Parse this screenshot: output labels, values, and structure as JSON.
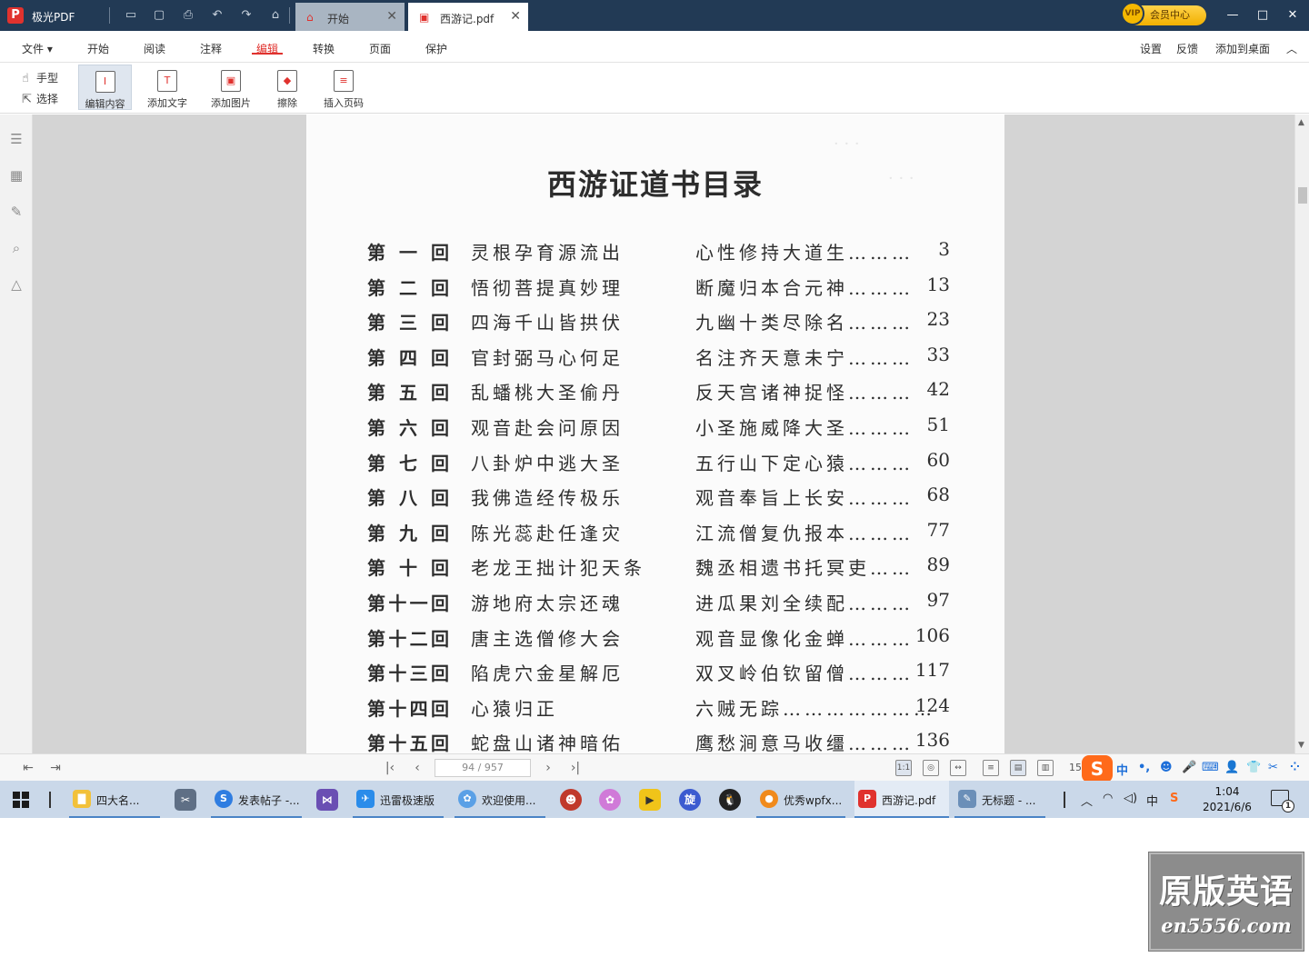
{
  "titlebar": {
    "app_name": "极光PDF",
    "tabs": [
      {
        "label": "开始",
        "active": false
      },
      {
        "label": "西游记.pdf",
        "active": true
      }
    ],
    "vip_label": "会员中心",
    "vip_badge": "VIP",
    "window_buttons": {
      "minimize": "—",
      "maximize": "□",
      "close": "✕"
    }
  },
  "menu": {
    "file": "文件 ▾",
    "items": [
      "开始",
      "阅读",
      "注释",
      "编辑",
      "转换",
      "页面",
      "保护"
    ],
    "active": "编辑",
    "right": [
      "设置",
      "反馈",
      "添加到桌面"
    ],
    "collapse": "︿"
  },
  "toolbar": {
    "hand": "手型",
    "select": "选择",
    "buttons": [
      {
        "label": "编辑内容",
        "glyph": "I",
        "selected": true
      },
      {
        "label": "添加文字",
        "glyph": "T",
        "selected": false
      },
      {
        "label": "添加图片",
        "glyph": "▣",
        "selected": false
      },
      {
        "label": "擦除",
        "glyph": "◆",
        "selected": false
      },
      {
        "label": "插入页码",
        "glyph": "≡",
        "selected": false
      }
    ]
  },
  "left_panel_icons": [
    "outline-icon",
    "thumbnails-icon",
    "annotations-icon",
    "search-icon",
    "signature-icon"
  ],
  "document": {
    "title": "西游证道书目录",
    "rows": [
      {
        "chapter": "第一回",
        "part1": "灵根孕育源流出",
        "part2": "心性修持大道生………",
        "page": "3"
      },
      {
        "chapter": "第二回",
        "part1": "悟彻菩提真妙理",
        "part2": "断魔归本合元神………",
        "page": "13"
      },
      {
        "chapter": "第三回",
        "part1": "四海千山皆拱伏",
        "part2": "九幽十类尽除名………",
        "page": "23"
      },
      {
        "chapter": "第四回",
        "part1": "官封弼马心何足",
        "part2": "名注齐天意未宁………",
        "page": "33"
      },
      {
        "chapter": "第五回",
        "part1": "乱蟠桃大圣偷丹",
        "part2": "反天宫诸神捉怪………",
        "page": "42"
      },
      {
        "chapter": "第六回",
        "part1": "观音赴会问原因",
        "part2": "小圣施威降大圣………",
        "page": "51"
      },
      {
        "chapter": "第七回",
        "part1": "八卦炉中逃大圣",
        "part2": "五行山下定心猿………",
        "page": "60"
      },
      {
        "chapter": "第八回",
        "part1": "我佛造经传极乐",
        "part2": "观音奉旨上长安………",
        "page": "68"
      },
      {
        "chapter": "第九回",
        "part1": "陈光蕊赴任逢灾",
        "part2": "江流僧复仇报本………",
        "page": "77"
      },
      {
        "chapter": "第十回",
        "part1": "老龙王拙计犯天条",
        "part2": "魏丞相遗书托冥吏……",
        "page": "89"
      },
      {
        "chapter": "第十一回",
        "part1": "游地府太宗还魂",
        "part2": "进瓜果刘全续配………",
        "page": "97"
      },
      {
        "chapter": "第十二回",
        "part1": "唐主选僧修大会",
        "part2": "观音显像化金蝉………",
        "page": "106"
      },
      {
        "chapter": "第十三回",
        "part1": "陷虎穴金星解厄",
        "part2": "双叉岭伯钦留僧………",
        "page": "117"
      },
      {
        "chapter": "第十四回",
        "part1": "心猿归正",
        "part2": "六贼无踪…………………",
        "page": "124"
      },
      {
        "chapter": "第十五回",
        "part1": "蛇盘山诸神暗佑",
        "part2": "鹰愁涧意马收缰………",
        "page": "136"
      }
    ]
  },
  "status": {
    "page_indicator": "94 / 957",
    "zoom_partial": "15",
    "ime_logo": "S",
    "ime_items": [
      "中",
      "•,",
      "☻",
      "🎤",
      "⌨",
      "👤",
      "👕",
      "✂",
      "⁘"
    ]
  },
  "taskbar": {
    "tasks": [
      {
        "label": "四大名...",
        "color": "#f2c13a",
        "glyph": "▇"
      },
      {
        "label": "发表帖子 -...",
        "color": "#2f7de1",
        "glyph": "S"
      },
      {
        "label": "迅雷极速版",
        "color": "#2a8cea",
        "glyph": "✈"
      },
      {
        "label": "欢迎使用...",
        "color": "#5aa0e6",
        "glyph": "✿"
      },
      {
        "label": "优秀wpfx...",
        "color": "#f08a1c",
        "glyph": "●"
      },
      {
        "label": "西游记.pdf",
        "color": "#e0322e",
        "glyph": "P"
      },
      {
        "label": "无标题 - ...",
        "color": "#6b8fb8",
        "glyph": "✎"
      }
    ],
    "tray": {
      "chevron": "︿",
      "ime": "中",
      "ime_logo": "S"
    },
    "time": "1:04",
    "date": "2021/6/6",
    "notifications": "1"
  },
  "watermark": {
    "line1": "原版英语",
    "line2": "en5556.com"
  }
}
